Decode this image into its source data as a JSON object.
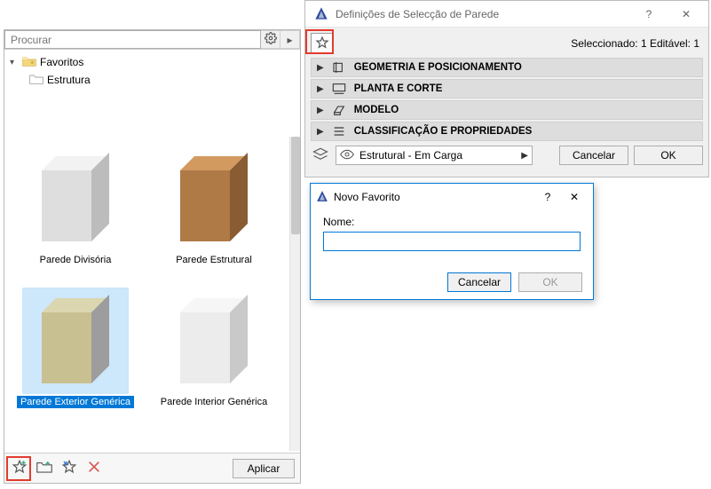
{
  "search": {
    "placeholder": "Procurar"
  },
  "tree": {
    "root": {
      "label": "Favoritos",
      "icon": "star-folder"
    },
    "child": {
      "label": "Estrutura",
      "icon": "folder"
    }
  },
  "thumbs": [
    {
      "label": "Parede Divisória",
      "selected": false,
      "front": "#dedede",
      "top": "#f2f2f2",
      "side": "#bcbcbc"
    },
    {
      "label": "Parede Estrutural",
      "selected": false,
      "front": "#b07a47",
      "top": "#d39a60",
      "side": "#8a5c33"
    },
    {
      "label": "Parede Exterior Genérica",
      "selected": true,
      "front": "#c8c090",
      "top": "#dcd6b0",
      "side": "#9d9d9d"
    },
    {
      "label": "Parede Interior Genérica",
      "selected": false,
      "front": "#ececec",
      "top": "#f6f6f6",
      "side": "#c9c9c9"
    }
  ],
  "bottom": {
    "apply": "Aplicar",
    "icons": [
      "add-favorite",
      "new-folder",
      "favorite",
      "delete"
    ]
  },
  "dialog": {
    "title": "Definições de Selecção de Parede",
    "selection_info": "Seleccionado: 1 Editável: 1",
    "sections": [
      {
        "label": "GEOMETRIA E POSICIONAMENTO",
        "icon": "geometry"
      },
      {
        "label": "PLANTA E CORTE",
        "icon": "plan"
      },
      {
        "label": "MODELO",
        "icon": "model"
      },
      {
        "label": "CLASSIFICAÇÃO E PROPRIEDADES",
        "icon": "list"
      }
    ],
    "layer": {
      "value": "Estrutural - Em Carga"
    },
    "cancel": "Cancelar",
    "ok": "OK"
  },
  "sub": {
    "title": "Novo Favorito",
    "name_label": "Nome:",
    "name_value": "",
    "cancel": "Cancelar",
    "ok": "OK"
  }
}
